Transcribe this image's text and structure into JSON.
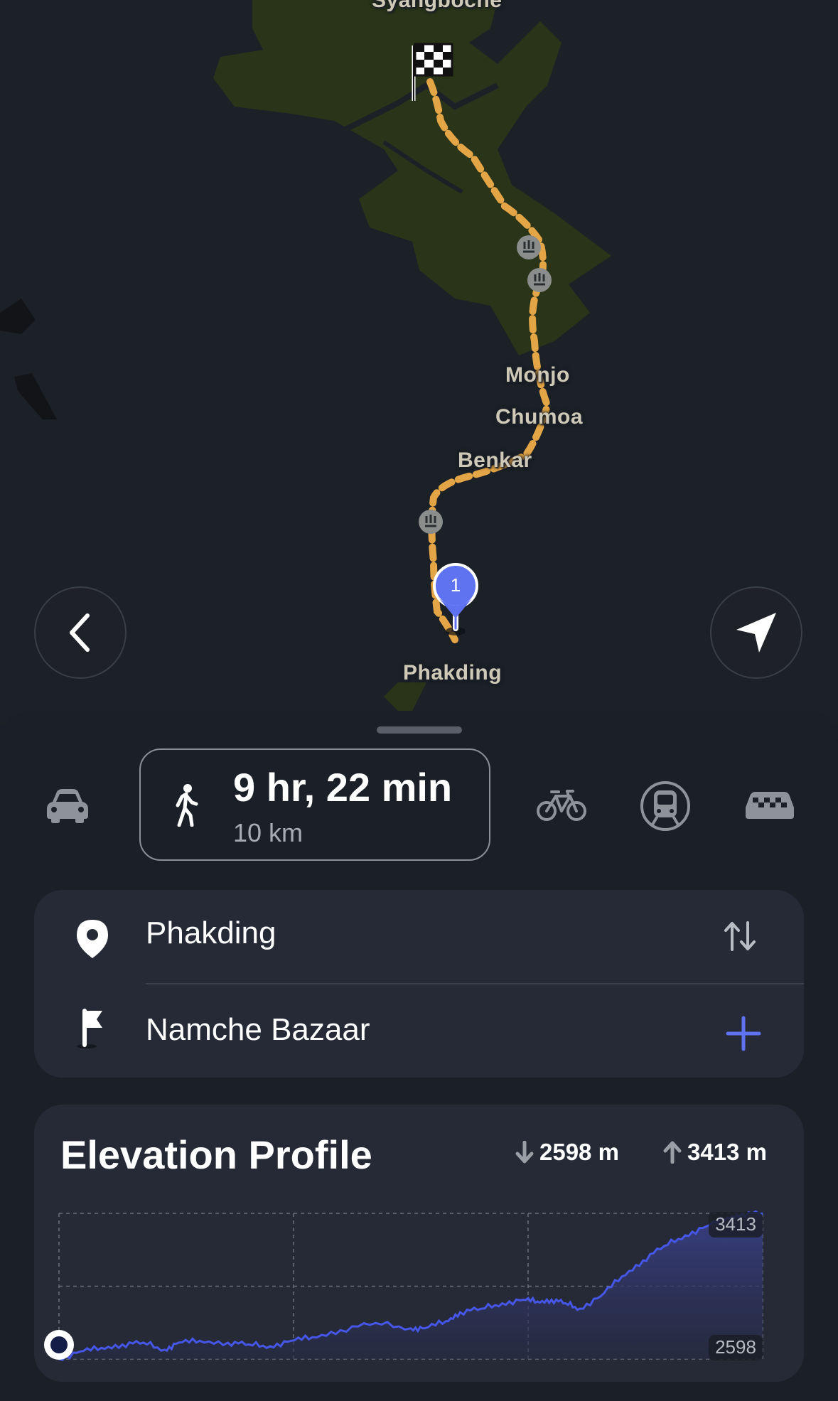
{
  "map": {
    "labels": {
      "top": "Syangboche",
      "monjo": "Monjo",
      "chumoa": "Chumoa",
      "benkar": "Benkar",
      "phakding": "Phakding"
    },
    "start_marker_number": "1",
    "route_color": "#e3a545",
    "marker_color": "#5f72f0"
  },
  "modes": {
    "walk": {
      "time": "9 hr, 22 min",
      "distance": "10 km",
      "icon": "walking-person-icon"
    },
    "others": [
      "car-icon",
      "bicycle-icon",
      "train-icon",
      "taxi-icon"
    ]
  },
  "route": {
    "from": "Phakding",
    "to": "Namche Bazaar"
  },
  "elevation": {
    "title": "Elevation Profile",
    "min_label": "2598 m",
    "max_label": "3413 m"
  },
  "chart_data": {
    "type": "area",
    "title": "Elevation Profile",
    "xlabel": "",
    "ylabel": "",
    "y_tick_labels": [
      "3413",
      "2598"
    ],
    "ylim": [
      2598,
      3413
    ],
    "x": [
      0,
      0.03,
      0.06,
      0.09,
      0.12,
      0.15,
      0.17,
      0.2,
      0.24,
      0.27,
      0.3,
      0.33,
      0.36,
      0.4,
      0.45,
      0.5,
      0.52,
      0.55,
      0.57,
      0.6,
      0.63,
      0.66,
      0.68,
      0.7,
      0.72,
      0.74,
      0.77,
      0.8,
      0.83,
      0.86,
      0.89,
      0.92,
      0.95,
      0.97,
      1.0
    ],
    "values": [
      2598,
      2640,
      2660,
      2680,
      2690,
      2650,
      2690,
      2700,
      2690,
      2680,
      2670,
      2700,
      2720,
      2760,
      2800,
      2770,
      2770,
      2810,
      2860,
      2880,
      2910,
      2930,
      2920,
      2930,
      2910,
      2880,
      2950,
      3060,
      3150,
      3230,
      3290,
      3340,
      3390,
      3410,
      3413
    ],
    "grid": true,
    "color": "#4656e6"
  }
}
